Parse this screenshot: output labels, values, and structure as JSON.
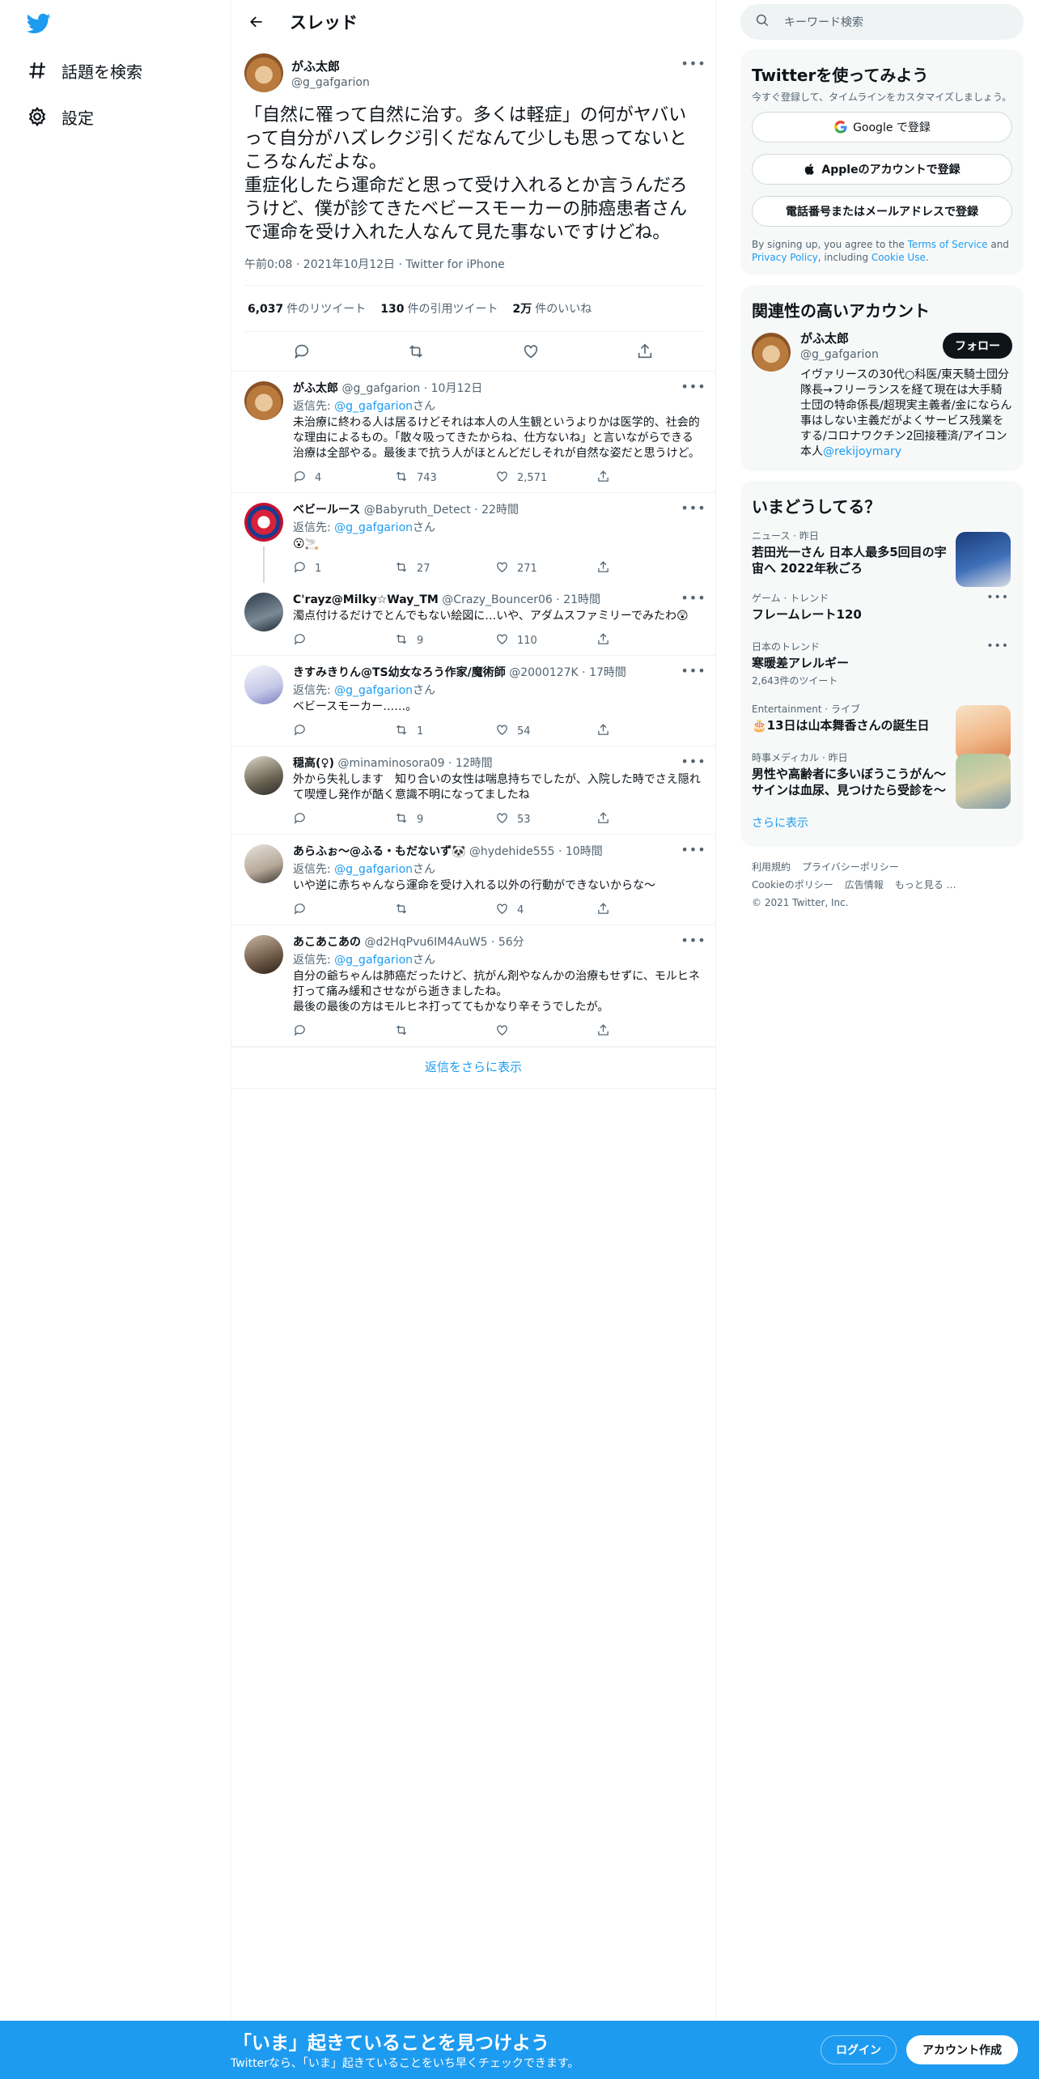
{
  "nav": {
    "explore_label": "話題を検索",
    "settings_label": "設定"
  },
  "header": {
    "title": "スレッド"
  },
  "focus_tweet": {
    "name": "がふ太郎",
    "handle": "@g_gafgarion",
    "text": "「自然に罹って自然に治す。多くは軽症」の何がヤバいって自分がハズレクジ引くだなんて少しも思ってないところなんだよな。\n重症化したら運命だと思って受け入れるとか言うんだろうけど、僕が診てきたベビースモーカーの肺癌患者さんで運命を受け入れた人なんて見た事ないですけどね。",
    "meta": "午前0:08 · 2021年10月12日 · Twitter for iPhone",
    "retweets_num": "6,037",
    "retweets_label": "件のリツイート",
    "quotes_num": "130",
    "quotes_label": "件の引用ツイート",
    "likes_num": "2万",
    "likes_label": "件のいいね"
  },
  "replies": [
    {
      "name": "がふ太郎",
      "handle": "@g_gafgarion · 10月12日",
      "reply_prefix": "返信先: ",
      "reply_to": "@g_gafgarion",
      "reply_suffix": "さん",
      "text": "未治療に終わる人は居るけどそれは本人の人生観というよりかは医学的、社会的な理由によるもの。「散々吸ってきたからね、仕方ないね」と言いながらできる治療は全部やる。最後まで抗う人がほとんどだしそれが自然な姿だと思うけど。",
      "replies": "4",
      "retweets": "743",
      "likes": "2,571"
    },
    {
      "name": "ベビールース",
      "handle": "@Babyruth_Detect · 22時間",
      "reply_prefix": "返信先: ",
      "reply_to": "@g_gafgarion",
      "reply_suffix": "さん",
      "text": "😮🚬",
      "replies": "1",
      "retweets": "27",
      "likes": "271"
    },
    {
      "name": "C'rayz@Milky☆Way_TM",
      "handle": "@Crazy_Bouncer06 · 21時間",
      "text": "濁点付けるだけでとんでもない絵図に…いや、アダムスファミリーでみたわ😲",
      "replies": "",
      "retweets": "9",
      "likes": "110"
    },
    {
      "name": "きすみきりん@TS幼女なろう作家/魔術師",
      "handle": "@2000127K · 17時間",
      "reply_prefix": "返信先: ",
      "reply_to": "@g_gafgarion",
      "reply_suffix": "さん",
      "text": "ベビースモーカー……。",
      "replies": "",
      "retweets": "1",
      "likes": "54"
    },
    {
      "name": "穏高(♀)",
      "handle": "@minaminosora09 · 12時間",
      "text": "外から失礼します　知り合いの女性は喘息持ちでしたが、入院した時でさえ隠れて喫煙し発作が酷く意識不明になってましたね",
      "replies": "",
      "retweets": "9",
      "likes": "53"
    },
    {
      "name": "あらふぉ〜@ふる・もだないず🐼",
      "handle": "@hydehide555 · 10時間",
      "reply_prefix": "返信先: ",
      "reply_to": "@g_gafgarion",
      "reply_suffix": "さん",
      "text": "いや逆に赤ちゃんなら運命を受け入れる以外の行動ができないからな〜",
      "replies": "",
      "retweets": "",
      "likes": "4"
    },
    {
      "name": "あこあこあの",
      "handle": "@d2HqPvu6IM4AuW5 · 56分",
      "reply_prefix": "返信先: ",
      "reply_to": "@g_gafgarion",
      "reply_suffix": "さん",
      "text": "自分の爺ちゃんは肺癌だったけど、抗がん剤やなんかの治療もせずに、モルヒネ打って痛み緩和させながら逝きましたね。\n最後の最後の方はモルヒネ打っててもかなり辛そうでしたが。",
      "replies": "",
      "retweets": "",
      "likes": ""
    }
  ],
  "show_more_replies": "返信をさらに表示",
  "search": {
    "placeholder": "キーワード検索"
  },
  "signup_card": {
    "title": "Twitterを使ってみよう",
    "sub": "今すぐ登録して、タイムラインをカスタマイズしましょう。",
    "google": "Google で登録",
    "apple": "Appleのアカウントで登録",
    "phone": "電話番号またはメールアドレスで登録",
    "terms_pre": "By signing up, you agree to the ",
    "terms_link": "Terms of Service",
    "terms_and": " and ",
    "privacy_link": "Privacy Policy",
    "including": ", including ",
    "cookie_link": "Cookie Use",
    "period": "."
  },
  "related": {
    "title": "関連性の高いアカウント",
    "name": "がふ太郎",
    "handle": "@g_gafgarion",
    "follow": "フォロー",
    "bio": "イヴァリースの30代○科医/東天騎士団分隊長→フリーランスを経て現在は大手騎士団の特命係長/超現実主義者/金にならん事はしない主義だがよくサービス残業をする/コロナワクチン2回接種済/アイコン本人",
    "bio_link": "@rekijoymary"
  },
  "trends": {
    "title": "いまどうしてる？",
    "items": [
      {
        "context": "ニュース · 昨日",
        "title": "若田光一さん 日本人最多5回目の宇宙へ 2022年秋ごろ",
        "count": ""
      },
      {
        "context": "ゲーム · トレンド",
        "title": "フレームレート120",
        "count": ""
      },
      {
        "context": "日本のトレンド",
        "title": "寒暖差アレルギー",
        "count": "2,643件のツイート"
      },
      {
        "context": "Entertainment · ライブ",
        "title": "🎂13日は山本舞香さんの誕生日",
        "count": ""
      },
      {
        "context": "時事メディカル · 昨日",
        "title": "男性や高齢者に多いぼうこうがん～サインは血尿、見つけたら受診を～",
        "count": ""
      }
    ],
    "show_more": "さらに表示"
  },
  "footer": {
    "l1": "利用規約",
    "l2": "プライバシーポリシー",
    "l3": "Cookieのポリシー",
    "l4": "広告情報",
    "l5": "もっと見る …",
    "copy": "© 2021 Twitter, Inc."
  },
  "banner": {
    "title": "「いま」起きていることを見つけよう",
    "sub": "Twitterなら、「いま」起きていることをいち早くチェックできます。",
    "login": "ログイン",
    "signup": "アカウント作成"
  },
  "colors": {
    "accent": "#1d9bf0",
    "text": "#0f1419",
    "muted": "#536471"
  }
}
